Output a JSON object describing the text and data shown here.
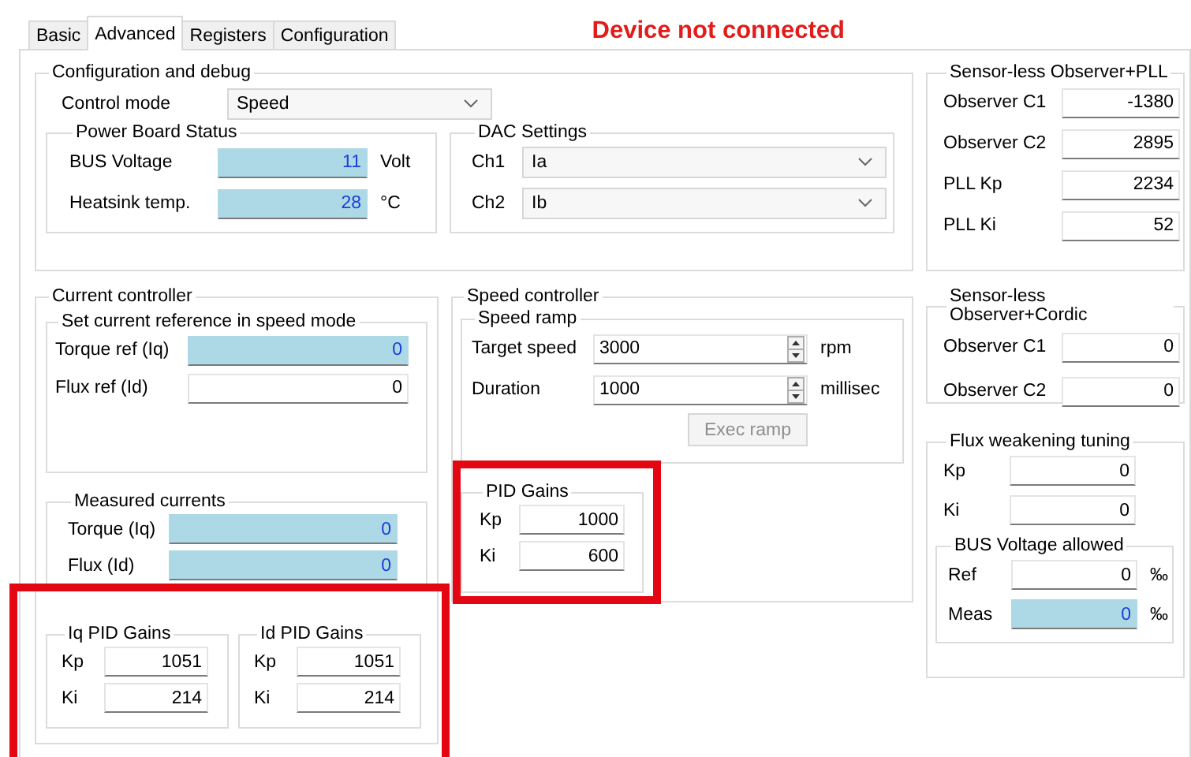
{
  "tabs": [
    {
      "label": "Basic",
      "selected": false
    },
    {
      "label": "Advanced",
      "selected": true
    },
    {
      "label": "Registers",
      "selected": false
    },
    {
      "label": "Configuration",
      "selected": false
    }
  ],
  "status": "Device not connected",
  "config_debug": {
    "title": "Configuration and debug",
    "control_mode": {
      "label": "Control mode",
      "value": "Speed"
    },
    "power_board": {
      "title": "Power Board Status",
      "rows": [
        {
          "label": "BUS Voltage",
          "value": "11",
          "unit": "Volt",
          "readonly": true
        },
        {
          "label": "Heatsink temp.",
          "value": "28",
          "unit": "°C",
          "readonly": true
        }
      ]
    },
    "dac": {
      "title": "DAC Settings",
      "rows": [
        {
          "label": "Ch1",
          "value": "Ia"
        },
        {
          "label": "Ch2",
          "value": "Ib"
        }
      ]
    }
  },
  "observer_pll": {
    "title": "Sensor-less Observer+PLL",
    "rows": [
      {
        "label": "Observer C1",
        "value": "-1380",
        "readonly": false
      },
      {
        "label": "Observer C2",
        "value": "2895",
        "readonly": false
      },
      {
        "label": "PLL Kp",
        "value": "2234",
        "readonly": false
      },
      {
        "label": "PLL Ki",
        "value": "52",
        "readonly": false
      }
    ]
  },
  "current_controller": {
    "title": "Current controller",
    "reference": {
      "title": "Set current reference in speed mode",
      "rows": [
        {
          "label": "Torque ref (Iq)",
          "value": "0",
          "readonly": true
        },
        {
          "label": "Flux ref (Id)",
          "value": "0",
          "readonly": false
        }
      ]
    },
    "measured": {
      "title": "Measured currents",
      "rows": [
        {
          "label": "Torque (Iq)",
          "value": "0",
          "readonly": true
        },
        {
          "label": "Flux (Id)",
          "value": "0",
          "readonly": true
        }
      ]
    },
    "pid_highlighted": true,
    "pid_groups": [
      {
        "title": "Iq PID Gains",
        "rows": [
          {
            "label": "Kp",
            "value": "1051",
            "readonly": false
          },
          {
            "label": "Ki",
            "value": "214",
            "readonly": false
          }
        ]
      },
      {
        "title": "Id PID Gains",
        "rows": [
          {
            "label": "Kp",
            "value": "1051",
            "readonly": false
          },
          {
            "label": "Ki",
            "value": "214",
            "readonly": false
          }
        ]
      }
    ]
  },
  "speed_controller": {
    "title": "Speed controller",
    "ramp": {
      "title": "Speed ramp",
      "rows": [
        {
          "label": "Target speed",
          "value": "3000",
          "unit": "rpm"
        },
        {
          "label": "Duration",
          "value": "1000",
          "unit": "millisec"
        }
      ],
      "button": {
        "label": "Exec ramp",
        "disabled": true
      }
    },
    "pid_gains": {
      "title": "PID Gains",
      "highlighted": true,
      "rows": [
        {
          "label": "Kp",
          "value": "1000",
          "readonly": false
        },
        {
          "label": "Ki",
          "value": "600",
          "readonly": false
        }
      ]
    }
  },
  "observer_cordic": {
    "title": "Sensor-less Observer+Cordic",
    "rows": [
      {
        "label": "Observer C1",
        "value": "0",
        "readonly": false
      },
      {
        "label": "Observer C2",
        "value": "0",
        "readonly": false
      }
    ]
  },
  "flux_weakening": {
    "title": "Flux weakening tuning",
    "rows": [
      {
        "label": "Kp",
        "value": "0",
        "readonly": false
      },
      {
        "label": "Ki",
        "value": "0",
        "readonly": false
      }
    ],
    "bus_voltage": {
      "title": "BUS Voltage allowed",
      "rows": [
        {
          "label": "Ref",
          "value": "0",
          "unit": "‰",
          "readonly": false
        },
        {
          "label": "Meas",
          "value": "0",
          "unit": "‰",
          "readonly": true
        }
      ]
    }
  }
}
